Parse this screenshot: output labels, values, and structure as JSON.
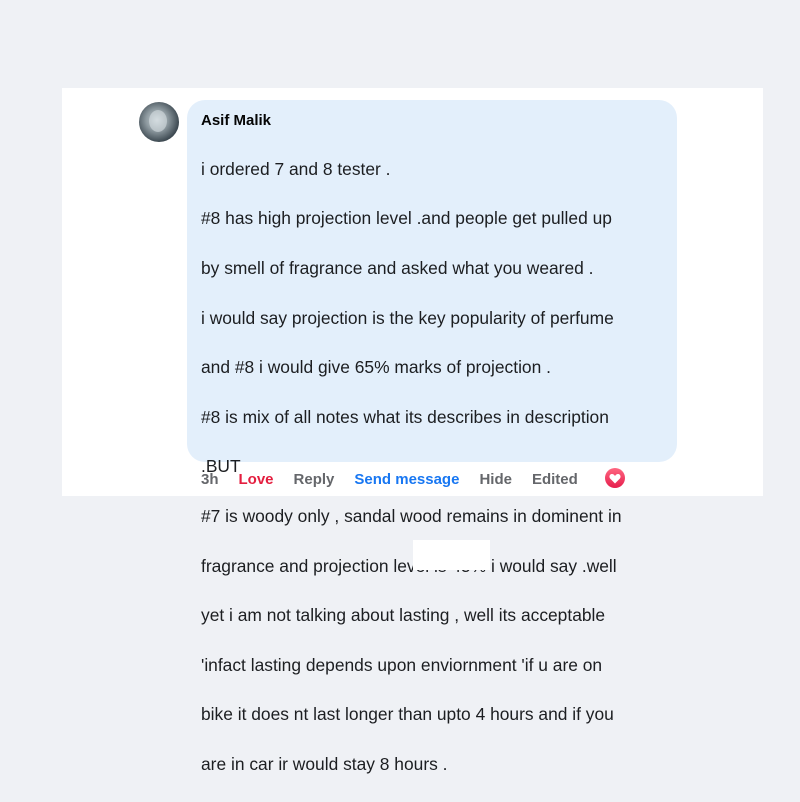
{
  "comment": {
    "author": "Asif Malik",
    "text_lines": [
      "i ordered 7 and 8 tester .",
      "#8 has high projection level .and people get pulled up",
      "by smell of fragrance and asked what you weared .",
      "i would say projection is the key popularity of perfume",
      "and #8 i would give 65% marks of projection .",
      "#8 is mix of all notes what its describes in description",
      ".BUT",
      "#7 is woody only , sandal wood remains in dominent in",
      "fragrance and projection level is 45% i would say .well",
      "yet i am not talking about lasting , well its acceptable",
      "'infact lasting depends upon enviornment 'if u are on",
      "bike it does nt last longer than upto 4 hours and if you",
      "are in car ir would stay 8 hours ."
    ]
  },
  "actions": {
    "time": "3h",
    "love": "Love",
    "reply": "Reply",
    "send_message": "Send message",
    "hide": "Hide",
    "edited": "Edited"
  },
  "reaction": {
    "icon": "heart-icon",
    "color": "#f33e58"
  },
  "colors": {
    "bubble": "#e3effb",
    "love": "#e41e3f",
    "send_message": "#1877f2",
    "muted": "#65676b"
  }
}
